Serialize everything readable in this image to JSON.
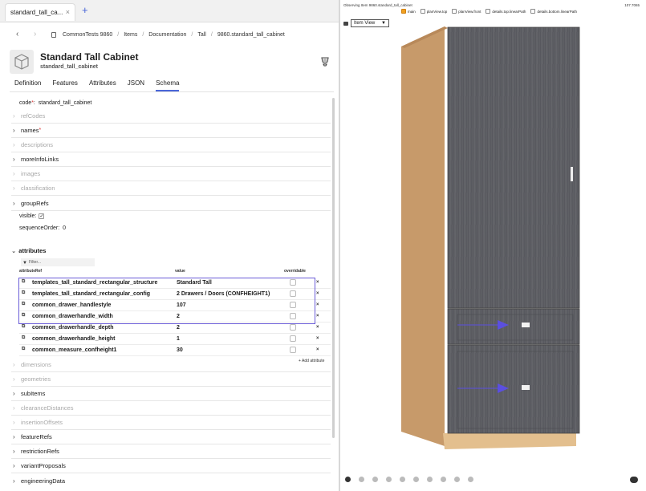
{
  "browser_tab": {
    "label": "standard_tall_ca...",
    "close": "×",
    "new_tab": "+"
  },
  "breadcrumb": [
    "CommonTests 9860",
    "Items",
    "Documentation",
    "Tall",
    "9860.standard_tall_cabinet"
  ],
  "item": {
    "title": "Standard Tall Cabinet",
    "code": "standard_tall_cabinet"
  },
  "tabs": [
    {
      "label": "Definition"
    },
    {
      "label": "Features"
    },
    {
      "label": "Attributes"
    },
    {
      "label": "JSON"
    },
    {
      "label": "Schema",
      "active": true
    }
  ],
  "schema": {
    "code_label": "code",
    "code_value": "standard_tall_cabinet",
    "refCodes": "refCodes",
    "names": "names",
    "descriptions": "descriptions",
    "moreInfoLinks": "moreInfoLinks",
    "images": "images",
    "classification": "classification",
    "groupRefs": "groupRefs",
    "visible_label": "visible:",
    "visible_value": "✓",
    "sequenceOrder_label": "sequenceOrder:",
    "sequenceOrder_value": "0",
    "attributes": "attributes",
    "dimensions": "dimensions",
    "geometries": "geometries",
    "subItems": "subItems",
    "clearanceDistances": "clearanceDistances",
    "insertionOffsets": "insertionOffsets",
    "featureRefs": "featureRefs",
    "restrictionRefs": "restrictionRefs",
    "variantProposals": "variantProposals",
    "engineeringData": "engineeringData"
  },
  "attribute_table": {
    "filter_placeholder": "Filter...",
    "columns": {
      "ref": "attributeRef",
      "value": "value",
      "overridable": "overridable"
    },
    "rows": [
      {
        "ref": "templates_tall_standard_rectangular_structure",
        "value": "Standard Tall"
      },
      {
        "ref": "templates_tall_standard_rectangular_config",
        "value": "2 Drawers / Doors (CONFHEIGHT1)"
      },
      {
        "ref": "common_drawer_handlestyle",
        "value": "107"
      },
      {
        "ref": "common_drawerhandle_width",
        "value": "2"
      },
      {
        "ref": "common_drawerhandle_depth",
        "value": "2"
      },
      {
        "ref": "common_drawerhandle_height",
        "value": "1"
      },
      {
        "ref": "common_measure_confheight1",
        "value": "30"
      }
    ],
    "delete_glyph": "×",
    "add_label": "+ Add attribute"
  },
  "viewer": {
    "status": "Observing Item 9860.standard_tall_cabinet",
    "size": "107.7065",
    "layers": [
      {
        "label": "main",
        "checked": true
      },
      {
        "label": "planView.top",
        "checked": false
      },
      {
        "label": "planView.front",
        "checked": false
      },
      {
        "label": "details.top.linearPath",
        "checked": false
      },
      {
        "label": "details.bottom.linearPath",
        "checked": false
      }
    ],
    "view_mode": "Item View",
    "colors": {
      "carcass": "#c79a6a",
      "front": "#5f6065",
      "arrow": "#5b4fe0"
    }
  }
}
